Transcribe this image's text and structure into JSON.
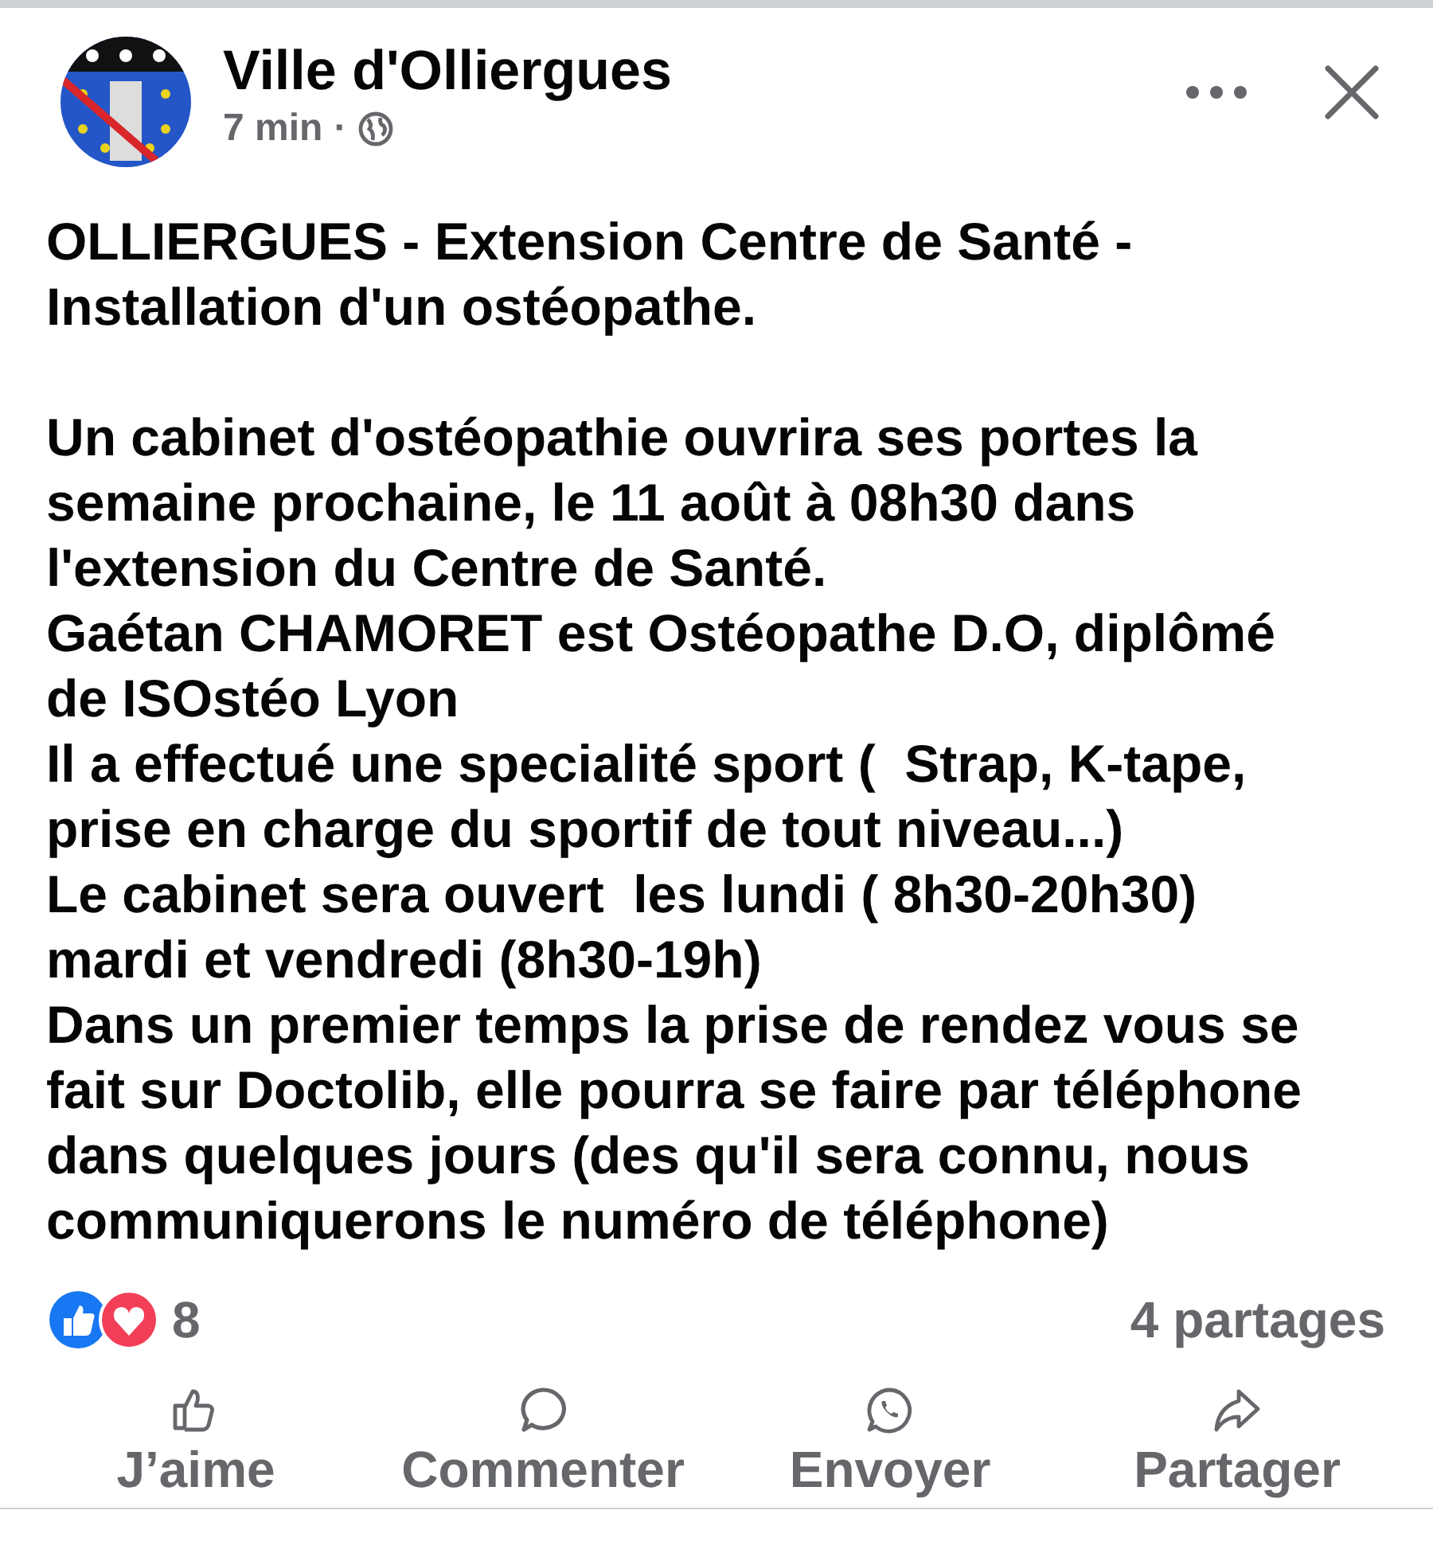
{
  "post": {
    "author": "Ville d'Olliergues",
    "time": "7 min",
    "separator": "·",
    "paragraphs": [
      {
        "lines": [
          {
            "text": "OLLIERGUES - Extension Centre de Santé -"
          },
          {
            "text": "Installation d'un ostéopathe."
          }
        ]
      },
      {
        "lines": [
          {
            "text": "Un cabinet d'ostéopathie ouvrira ses portes la"
          },
          {
            "text": "semaine prochaine, le 11 août à 08h30 dans"
          },
          {
            "text": "l'extension du Centre de Santé."
          },
          {
            "text": "Gaétan CHAMORET est Ostéopathe D.O, diplômé"
          },
          {
            "text": "de ISOstéo Lyon"
          },
          {
            "text": "Il a effectué une specialité sport (  Strap, K-tape,"
          },
          {
            "text": "prise en charge du sportif de tout niveau...)"
          },
          {
            "text": "Le cabinet sera ouvert  les lundi ( 8h30-20h30)"
          },
          {
            "text": "mardi et vendredi (8h30-19h)"
          },
          {
            "text": "Dans un premier temps la prise de rendez vous se"
          },
          {
            "text": "fait sur Doctolib, elle pourra se faire par téléphone"
          },
          {
            "text": "dans quelques jours (des qu'il sera connu, nous"
          },
          {
            "text": "communiquerons le numéro de téléphone)"
          }
        ]
      }
    ]
  },
  "reactions": {
    "count": "8",
    "shares": "4 partages"
  },
  "actions": [
    {
      "kind": "like",
      "label": "J’aime"
    },
    {
      "kind": "comment",
      "label": "Commenter"
    },
    {
      "kind": "send",
      "label": "Envoyer"
    },
    {
      "kind": "share",
      "label": "Partager"
    }
  ]
}
